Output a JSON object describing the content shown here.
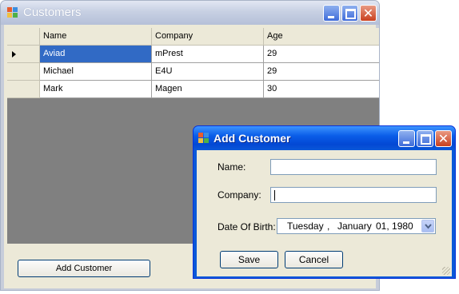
{
  "customers_window": {
    "title": "Customers",
    "grid": {
      "columns": [
        "Name",
        "Company",
        "Age"
      ],
      "rows": [
        {
          "name": "Aviad",
          "company": "mPrest",
          "age": "29"
        },
        {
          "name": "Michael",
          "company": "E4U",
          "age": "29"
        },
        {
          "name": "Mark",
          "company": "Magen",
          "age": "30"
        }
      ]
    },
    "add_button": "Add Customer"
  },
  "dialog": {
    "title": "Add Customer",
    "name_label": "Name:",
    "name_value": "",
    "company_label": "Company:",
    "company_value": "",
    "dob_label": "Date Of Birth:",
    "dob": {
      "weekday": "Tuesday",
      "sep": ",",
      "month": "January",
      "day_year": "01, 1980"
    },
    "save": "Save",
    "cancel": "Cancel"
  },
  "colors": {
    "selection": "#316ac5",
    "active_title": "#0a58d8",
    "inactive_title": "#c7d0e3"
  }
}
